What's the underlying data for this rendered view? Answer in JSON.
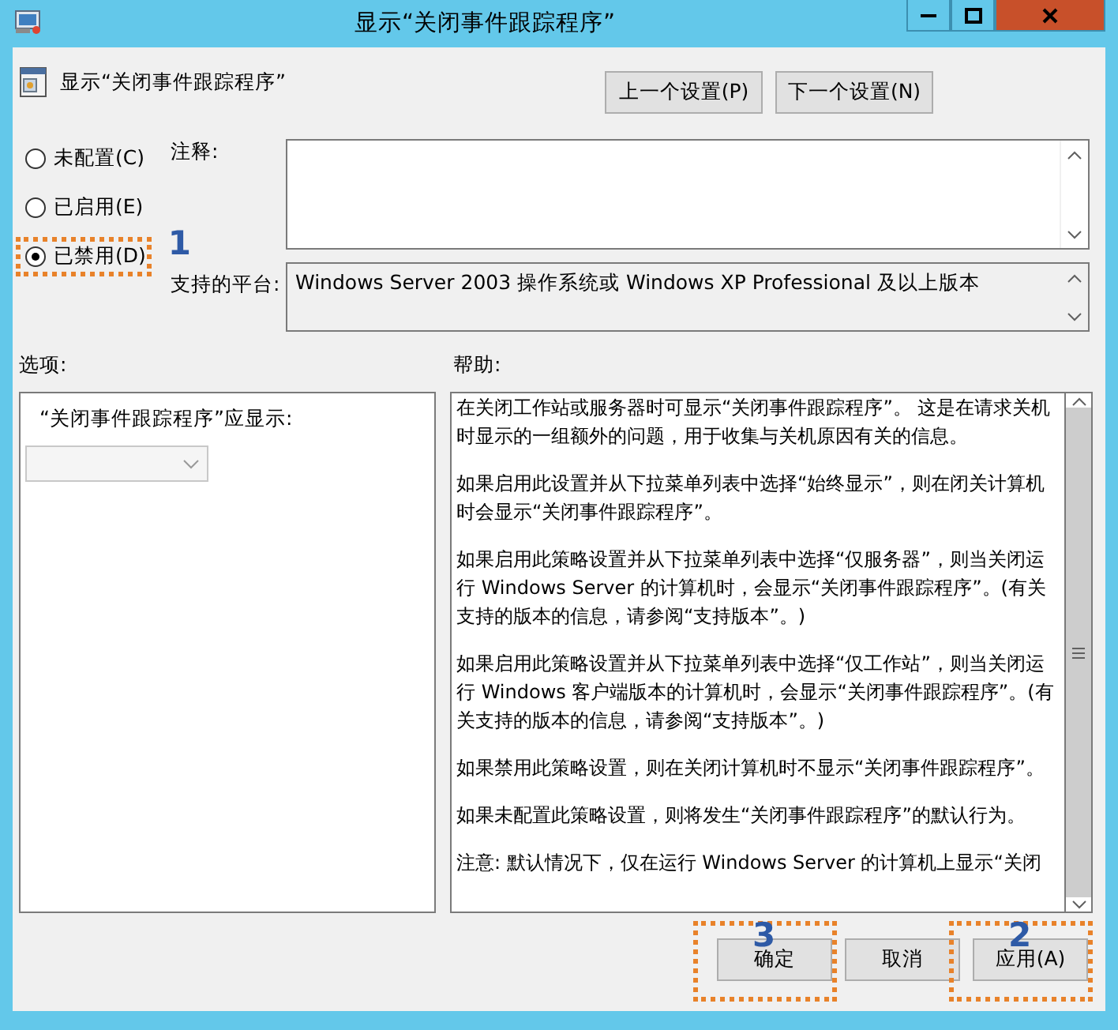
{
  "window": {
    "title": "显示“关闭事件跟踪程序”"
  },
  "header": {
    "title": "显示“关闭事件跟踪程序”"
  },
  "nav_buttons": [
    {
      "label": "上一个设置(P)"
    },
    {
      "label": "下一个设置(N)"
    }
  ],
  "state_options": [
    {
      "label": "未配置(C)",
      "selected": false
    },
    {
      "label": "已启用(E)",
      "selected": false
    },
    {
      "label": "已禁用(D)",
      "selected": true,
      "annotation": {
        "number": "1"
      }
    }
  ],
  "comment": {
    "label": "注释:"
  },
  "supported": {
    "label": "支持的平台:",
    "value": "Windows Server 2003 操作系统或 Windows XP Professional 及以上版本"
  },
  "options": {
    "label": "选项:",
    "caption": "“关闭事件跟踪程序”应显示:",
    "dropdown": {
      "disabled": true
    }
  },
  "help": {
    "label": "帮助:",
    "paragraphs": [
      "在关闭工作站或服务器时可显示“关闭事件跟踪程序”。 这是在请求关机时显示的一组额外的问题，用于收集与关机原因有关的信息。",
      "如果启用此设置并从下拉菜单列表中选择“始终显示”，则在闭关计算机时会显示“关闭事件跟踪程序”。",
      "如果启用此策略设置并从下拉菜单列表中选择“仅服务器”，则当关闭运行 Windows Server 的计算机时，会显示“关闭事件跟踪程序”。(有关支持的版本的信息，请参阅“支持版本”。)",
      "如果启用此策略设置并从下拉菜单列表中选择“仅工作站”，则当关闭运行 Windows 客户端版本的计算机时，会显示“关闭事件跟踪程序”。(有关支持的版本的信息，请参阅“支持版本”。)",
      "如果禁用此策略设置，则在关闭计算机时不显示“关闭事件跟踪程序”。",
      "如果未配置此策略设置，则将发生“关闭事件跟踪程序”的默认行为。",
      "注意: 默认情况下，仅在运行 Windows Server 的计算机上显示“关闭"
    ]
  },
  "footer_buttons": [
    {
      "label": "确定",
      "annotation": {
        "number": "3"
      }
    },
    {
      "label": "取消"
    },
    {
      "label": "应用(A)",
      "annotation": {
        "number": "2"
      }
    }
  ]
}
